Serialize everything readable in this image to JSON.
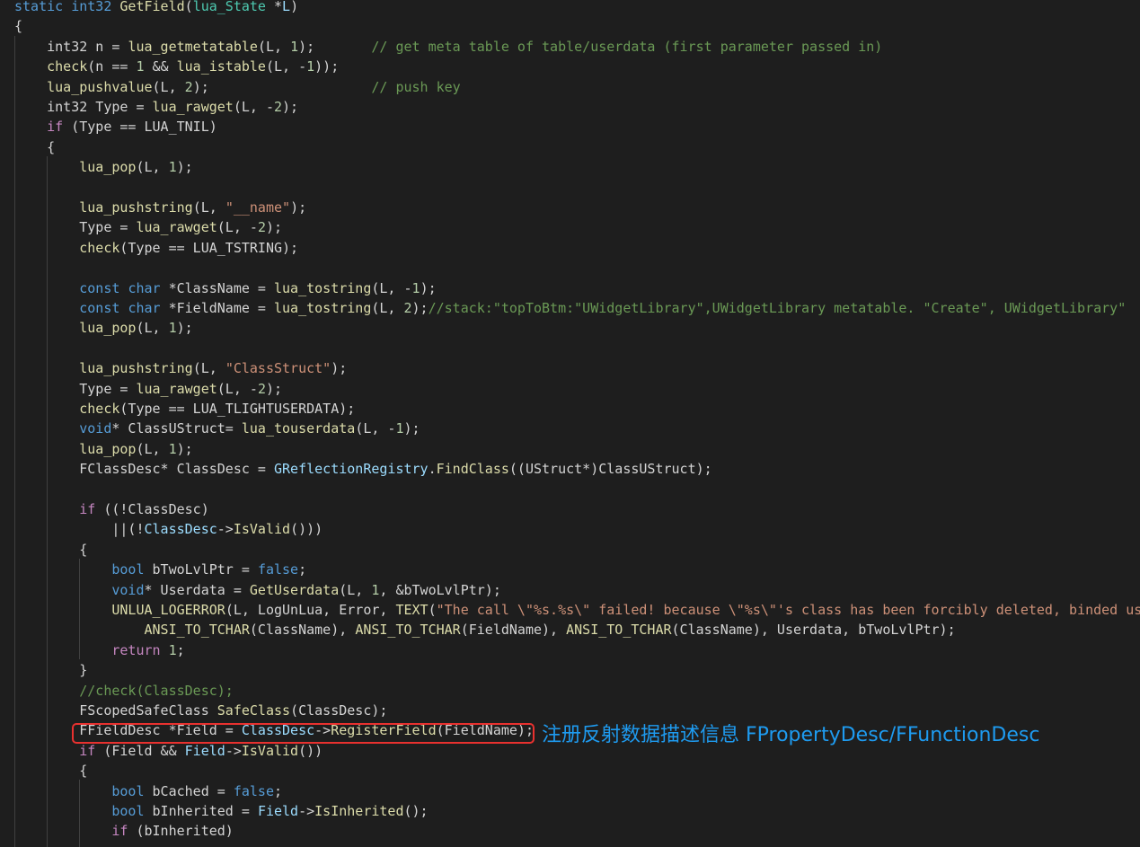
{
  "editor": {
    "theme": "dark",
    "background": "#1e1e1e"
  },
  "code_lines": [
    [
      {
        "t": "static ",
        "c": "kw"
      },
      {
        "t": "int32 ",
        "c": "kw"
      },
      {
        "t": "GetField",
        "c": "fn"
      },
      {
        "t": "(",
        "c": ""
      },
      {
        "t": "lua_State ",
        "c": "ty"
      },
      {
        "t": "*",
        "c": ""
      },
      {
        "t": "L",
        "c": "var"
      },
      {
        "t": ")",
        "c": ""
      }
    ],
    [
      {
        "t": "{",
        "c": ""
      }
    ],
    [
      {
        "t": "    int32 n = ",
        "c": ""
      },
      {
        "t": "lua_getmetatable",
        "c": "fn"
      },
      {
        "t": "(L, ",
        "c": ""
      },
      {
        "t": "1",
        "c": "num"
      },
      {
        "t": ");       ",
        "c": ""
      },
      {
        "t": "// get meta table of table/userdata (first parameter passed in)",
        "c": "cm"
      }
    ],
    [
      {
        "t": "    ",
        "c": ""
      },
      {
        "t": "check",
        "c": "fn"
      },
      {
        "t": "(n == ",
        "c": ""
      },
      {
        "t": "1",
        "c": "num"
      },
      {
        "t": " && ",
        "c": ""
      },
      {
        "t": "lua_istable",
        "c": "fn"
      },
      {
        "t": "(L, -",
        "c": ""
      },
      {
        "t": "1",
        "c": "num"
      },
      {
        "t": "));",
        "c": ""
      }
    ],
    [
      {
        "t": "    ",
        "c": ""
      },
      {
        "t": "lua_pushvalue",
        "c": "fn"
      },
      {
        "t": "(L, ",
        "c": ""
      },
      {
        "t": "2",
        "c": "num"
      },
      {
        "t": ");                    ",
        "c": ""
      },
      {
        "t": "// push key",
        "c": "cm"
      }
    ],
    [
      {
        "t": "    int32 Type = ",
        "c": ""
      },
      {
        "t": "lua_rawget",
        "c": "fn"
      },
      {
        "t": "(L, -",
        "c": ""
      },
      {
        "t": "2",
        "c": "num"
      },
      {
        "t": ");",
        "c": ""
      }
    ],
    [
      {
        "t": "    ",
        "c": ""
      },
      {
        "t": "if",
        "c": "ctl"
      },
      {
        "t": " (Type == LUA_TNIL)",
        "c": ""
      }
    ],
    [
      {
        "t": "    {",
        "c": ""
      }
    ],
    [
      {
        "t": "        ",
        "c": ""
      },
      {
        "t": "lua_pop",
        "c": "fn"
      },
      {
        "t": "(L, ",
        "c": ""
      },
      {
        "t": "1",
        "c": "num"
      },
      {
        "t": ");",
        "c": ""
      }
    ],
    [],
    [
      {
        "t": "        ",
        "c": ""
      },
      {
        "t": "lua_pushstring",
        "c": "fn"
      },
      {
        "t": "(L, ",
        "c": ""
      },
      {
        "t": "\"__name\"",
        "c": "str"
      },
      {
        "t": ");",
        "c": ""
      }
    ],
    [
      {
        "t": "        Type = ",
        "c": ""
      },
      {
        "t": "lua_rawget",
        "c": "fn"
      },
      {
        "t": "(L, -",
        "c": ""
      },
      {
        "t": "2",
        "c": "num"
      },
      {
        "t": ");",
        "c": ""
      }
    ],
    [
      {
        "t": "        ",
        "c": ""
      },
      {
        "t": "check",
        "c": "fn"
      },
      {
        "t": "(Type == LUA_TSTRING);",
        "c": ""
      }
    ],
    [],
    [
      {
        "t": "        ",
        "c": ""
      },
      {
        "t": "const ",
        "c": "kw"
      },
      {
        "t": "char ",
        "c": "kw"
      },
      {
        "t": "*ClassName = ",
        "c": ""
      },
      {
        "t": "lua_tostring",
        "c": "fn"
      },
      {
        "t": "(L, -",
        "c": ""
      },
      {
        "t": "1",
        "c": "num"
      },
      {
        "t": ");",
        "c": ""
      }
    ],
    [
      {
        "t": "        ",
        "c": ""
      },
      {
        "t": "const ",
        "c": "kw"
      },
      {
        "t": "char ",
        "c": "kw"
      },
      {
        "t": "*FieldName = ",
        "c": ""
      },
      {
        "t": "lua_tostring",
        "c": "fn"
      },
      {
        "t": "(L, ",
        "c": ""
      },
      {
        "t": "2",
        "c": "num"
      },
      {
        "t": ");",
        "c": ""
      },
      {
        "t": "//stack:\"topToBtm:\"UWidgetLibrary\",UWidgetLibrary metatable. \"Create\", UWidgetLibrary\"",
        "c": "cm"
      }
    ],
    [
      {
        "t": "        ",
        "c": ""
      },
      {
        "t": "lua_pop",
        "c": "fn"
      },
      {
        "t": "(L, ",
        "c": ""
      },
      {
        "t": "1",
        "c": "num"
      },
      {
        "t": ");",
        "c": ""
      }
    ],
    [],
    [
      {
        "t": "        ",
        "c": ""
      },
      {
        "t": "lua_pushstring",
        "c": "fn"
      },
      {
        "t": "(L, ",
        "c": ""
      },
      {
        "t": "\"ClassStruct\"",
        "c": "str"
      },
      {
        "t": ");",
        "c": ""
      }
    ],
    [
      {
        "t": "        Type = ",
        "c": ""
      },
      {
        "t": "lua_rawget",
        "c": "fn"
      },
      {
        "t": "(L, -",
        "c": ""
      },
      {
        "t": "2",
        "c": "num"
      },
      {
        "t": ");",
        "c": ""
      }
    ],
    [
      {
        "t": "        ",
        "c": ""
      },
      {
        "t": "check",
        "c": "fn"
      },
      {
        "t": "(Type == LUA_TLIGHTUSERDATA);",
        "c": ""
      }
    ],
    [
      {
        "t": "        ",
        "c": ""
      },
      {
        "t": "void",
        "c": "kw"
      },
      {
        "t": "* ClassUStruct= ",
        "c": ""
      },
      {
        "t": "lua_touserdata",
        "c": "fn"
      },
      {
        "t": "(L, -",
        "c": ""
      },
      {
        "t": "1",
        "c": "num"
      },
      {
        "t": ");",
        "c": ""
      }
    ],
    [
      {
        "t": "        ",
        "c": ""
      },
      {
        "t": "lua_pop",
        "c": "fn"
      },
      {
        "t": "(L, ",
        "c": ""
      },
      {
        "t": "1",
        "c": "num"
      },
      {
        "t": ");",
        "c": ""
      }
    ],
    [
      {
        "t": "        FClassDesc* ClassDesc = ",
        "c": ""
      },
      {
        "t": "GReflectionRegistry",
        "c": "var"
      },
      {
        "t": ".",
        "c": ""
      },
      {
        "t": "FindClass",
        "c": "fn"
      },
      {
        "t": "((UStruct*)ClassUStruct);",
        "c": ""
      }
    ],
    [],
    [
      {
        "t": "        ",
        "c": ""
      },
      {
        "t": "if",
        "c": "ctl"
      },
      {
        "t": " ((!ClassDesc)",
        "c": ""
      }
    ],
    [
      {
        "t": "            ||(!",
        "c": ""
      },
      {
        "t": "ClassDesc",
        "c": "var"
      },
      {
        "t": "->",
        "c": ""
      },
      {
        "t": "IsValid",
        "c": "fn"
      },
      {
        "t": "()))",
        "c": ""
      }
    ],
    [
      {
        "t": "        {",
        "c": ""
      }
    ],
    [
      {
        "t": "            ",
        "c": ""
      },
      {
        "t": "bool ",
        "c": "kw"
      },
      {
        "t": "bTwoLvlPtr = ",
        "c": ""
      },
      {
        "t": "false",
        "c": "kw"
      },
      {
        "t": ";",
        "c": ""
      }
    ],
    [
      {
        "t": "            ",
        "c": ""
      },
      {
        "t": "void",
        "c": "kw"
      },
      {
        "t": "* Userdata = ",
        "c": ""
      },
      {
        "t": "GetUserdata",
        "c": "fn"
      },
      {
        "t": "(L, ",
        "c": ""
      },
      {
        "t": "1",
        "c": "num"
      },
      {
        "t": ", &bTwoLvlPtr);",
        "c": ""
      }
    ],
    [
      {
        "t": "            ",
        "c": ""
      },
      {
        "t": "UNLUA_LOGERROR",
        "c": "fn"
      },
      {
        "t": "(L, LogUnLua, Error, ",
        "c": ""
      },
      {
        "t": "TEXT",
        "c": "fn"
      },
      {
        "t": "(",
        "c": ""
      },
      {
        "t": "\"The call \\\"%s.%s\\\" failed! because \\\"%s\\\"'s class has been forcibly deleted, binded us",
        "c": "str"
      }
    ],
    [
      {
        "t": "                ",
        "c": ""
      },
      {
        "t": "ANSI_TO_TCHAR",
        "c": "fn"
      },
      {
        "t": "(ClassName), ",
        "c": ""
      },
      {
        "t": "ANSI_TO_TCHAR",
        "c": "fn"
      },
      {
        "t": "(FieldName), ",
        "c": ""
      },
      {
        "t": "ANSI_TO_TCHAR",
        "c": "fn"
      },
      {
        "t": "(ClassName), Userdata, bTwoLvlPtr);",
        "c": ""
      }
    ],
    [
      {
        "t": "            ",
        "c": ""
      },
      {
        "t": "return ",
        "c": "ctl"
      },
      {
        "t": "1",
        "c": "num"
      },
      {
        "t": ";",
        "c": ""
      }
    ],
    [
      {
        "t": "        }",
        "c": ""
      }
    ],
    [
      {
        "t": "        ",
        "c": ""
      },
      {
        "t": "//check(ClassDesc);",
        "c": "cm"
      }
    ],
    [
      {
        "t": "        FScopedSafeClass ",
        "c": ""
      },
      {
        "t": "SafeClass",
        "c": "fn"
      },
      {
        "t": "(ClassDesc);",
        "c": ""
      }
    ],
    [
      {
        "t": "        FFieldDesc *Field = ",
        "c": ""
      },
      {
        "t": "ClassDesc",
        "c": "var"
      },
      {
        "t": "->",
        "c": ""
      },
      {
        "t": "RegisterField",
        "c": "fn"
      },
      {
        "t": "(FieldName);",
        "c": ""
      }
    ],
    [
      {
        "t": "        ",
        "c": ""
      },
      {
        "t": "if",
        "c": "ctl"
      },
      {
        "t": " (Field && ",
        "c": ""
      },
      {
        "t": "Field",
        "c": "var"
      },
      {
        "t": "->",
        "c": ""
      },
      {
        "t": "IsValid",
        "c": "fn"
      },
      {
        "t": "())",
        "c": ""
      }
    ],
    [
      {
        "t": "        {",
        "c": ""
      }
    ],
    [
      {
        "t": "            ",
        "c": ""
      },
      {
        "t": "bool ",
        "c": "kw"
      },
      {
        "t": "bCached = ",
        "c": ""
      },
      {
        "t": "false",
        "c": "kw"
      },
      {
        "t": ";",
        "c": ""
      }
    ],
    [
      {
        "t": "            ",
        "c": ""
      },
      {
        "t": "bool ",
        "c": "kw"
      },
      {
        "t": "bInherited = ",
        "c": ""
      },
      {
        "t": "Field",
        "c": "var"
      },
      {
        "t": "->",
        "c": ""
      },
      {
        "t": "IsInherited",
        "c": "fn"
      },
      {
        "t": "();",
        "c": ""
      }
    ],
    [
      {
        "t": "            ",
        "c": ""
      },
      {
        "t": "if",
        "c": "ctl"
      },
      {
        "t": " (bInherited)",
        "c": ""
      }
    ]
  ],
  "annotation": {
    "text": "注册反射数据描述信息 FPropertyDesc/FFunctionDesc",
    "color": "#1e9bf0",
    "box_color": "#e8312f"
  }
}
